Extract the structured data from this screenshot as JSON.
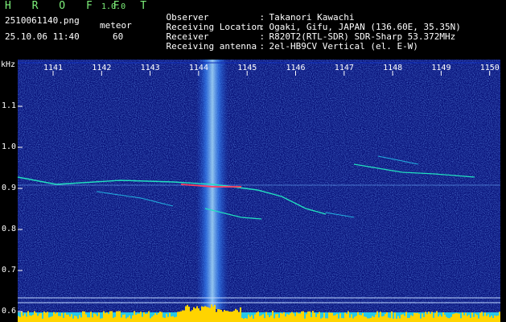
{
  "header": {
    "app_title": "HROFFT",
    "app_version": "1.0.0",
    "filename": "2510061140.png",
    "datetime": "25.10.06 11:40",
    "mode_label": "meteor",
    "mode_value": "60"
  },
  "info": [
    {
      "key": "Observer",
      "sep": ":",
      "value": "Takanori Kawachi"
    },
    {
      "key": "Receiving Location",
      "sep": ":",
      "value": "Ogaki, Gifu, JAPAN (136.60E, 35.35N)"
    },
    {
      "key": "Receiver",
      "sep": ":",
      "value": "R820T2(RTL-SDR) SDR-Sharp 53.372MHz"
    },
    {
      "key": "Receiving antenna",
      "sep": ":",
      "value": "2el-HB9CV Vertical (el. E-W)"
    }
  ],
  "axis": {
    "unit": "kHz",
    "x_ticks": [
      "1141",
      "1142",
      "1143",
      "1144",
      "1145",
      "1146",
      "1147",
      "1148",
      "1149",
      "1150"
    ],
    "y_ticks": [
      "1.1",
      "1.0",
      "0.9",
      "0.8",
      "0.7",
      "0.6"
    ]
  },
  "colors": {
    "background_noise": "#0a1a8a",
    "carrier": "#4fa8ff",
    "echo": "#22e0c0",
    "echo_core": "#ff4060",
    "spectrum": "#ffd400",
    "label_green": "#7df07a"
  }
}
